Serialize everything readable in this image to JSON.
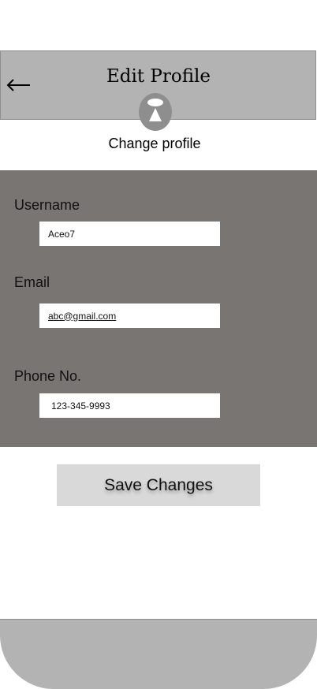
{
  "header": {
    "title": "Edit Profile",
    "back_icon": "arrow-left-icon"
  },
  "profile": {
    "avatar_icon": "user-silhouette-icon",
    "change_label": "Change profile"
  },
  "form": {
    "username": {
      "label": "Username",
      "value": "Aceo7"
    },
    "email": {
      "label": "Email",
      "value": "abc@gmail.com"
    },
    "phone": {
      "label": "Phone No.",
      "value": "123-345-9993"
    }
  },
  "actions": {
    "save_label": "Save Changes"
  },
  "colors": {
    "header_bg": "#b3b3b3",
    "form_bg": "#797573",
    "button_bg": "#d9d9d9"
  }
}
